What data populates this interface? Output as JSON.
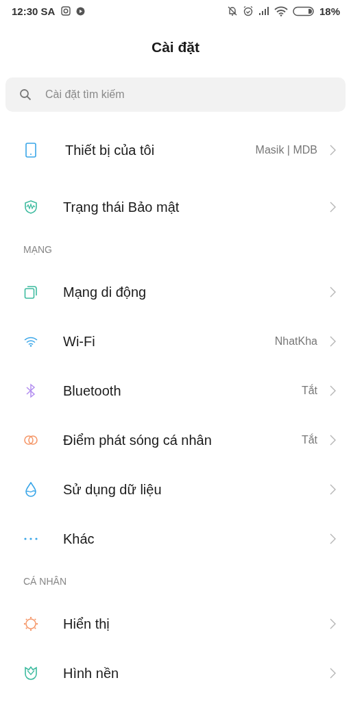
{
  "status_bar": {
    "time": "12:30 SA",
    "battery": "18%"
  },
  "title": "Cài đặt",
  "search": {
    "placeholder": "Cài đặt tìm kiếm"
  },
  "entries": [
    {
      "kind": "item",
      "label": "Thiết bị của tôi",
      "value": "Masik | MDB"
    },
    {
      "kind": "item",
      "label": "Trạng thái Bảo mật"
    },
    {
      "kind": "header",
      "label": "MẠNG"
    },
    {
      "kind": "item",
      "label": "Mạng di động"
    },
    {
      "kind": "item",
      "label": "Wi-Fi",
      "value": "NhatKha"
    },
    {
      "kind": "item",
      "label": "Bluetooth",
      "value": "Tắt"
    },
    {
      "kind": "item",
      "label": "Điểm phát sóng cá nhân",
      "value": "Tắt"
    },
    {
      "kind": "item",
      "label": "Sử dụng dữ liệu"
    },
    {
      "kind": "item",
      "label": "Khác"
    },
    {
      "kind": "header",
      "label": "CÁ NHÂN"
    },
    {
      "kind": "item",
      "label": "Hiển thị"
    },
    {
      "kind": "item",
      "label": "Hình nền"
    }
  ]
}
